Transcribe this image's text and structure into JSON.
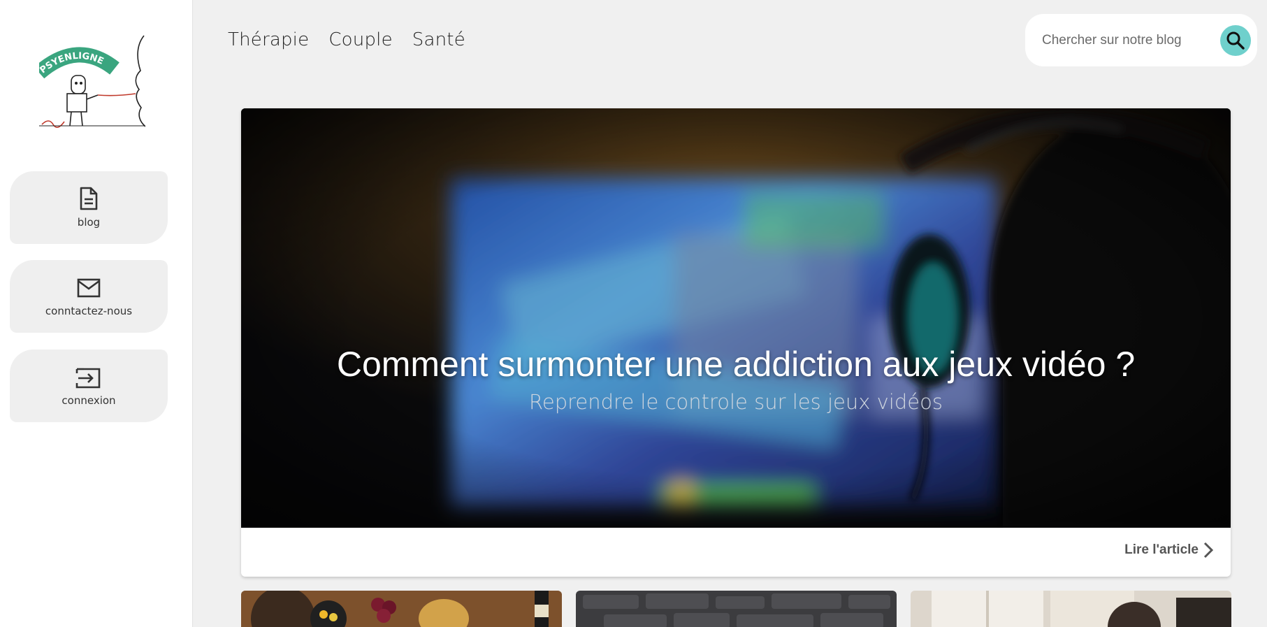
{
  "logo": {
    "text": "PSYENLIGNE",
    "accent": "#3aa57f"
  },
  "sidebar": {
    "items": [
      {
        "label": "blog",
        "icon": "document-icon"
      },
      {
        "label": "conntactez-nous",
        "icon": "mail-icon"
      },
      {
        "label": "connexion",
        "icon": "login-icon"
      }
    ]
  },
  "topnav": {
    "links": [
      "Thérapie",
      "Couple",
      "Santé"
    ]
  },
  "search": {
    "placeholder": "Chercher sur notre blog",
    "button_color": "#6fd0cc",
    "icon": "search-icon"
  },
  "hero": {
    "title": "Comment surmonter une addiction aux jeux vidéo ?",
    "subtitle": "Reprendre le controle sur les jeux vidéos",
    "read_more": "Lire l'article",
    "image": "gamer-with-headphones-in-front-of-tv"
  },
  "thumbnails": [
    {
      "image": "food-on-wooden-table"
    },
    {
      "image": "grey-stone-wall"
    },
    {
      "image": "bright-room-interior"
    }
  ]
}
